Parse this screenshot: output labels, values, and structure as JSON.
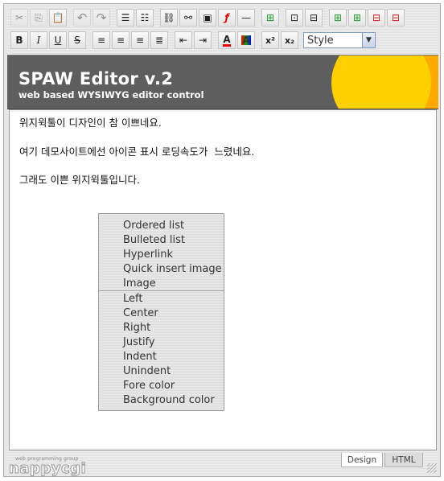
{
  "toolbar": {
    "row1": [
      {
        "icon": "cut-icon",
        "glyph": "✂",
        "dim": true
      },
      {
        "icon": "copy-icon",
        "glyph": "⎘",
        "dim": true
      },
      {
        "icon": "paste-icon",
        "glyph": "📋",
        "dim": false
      },
      {
        "sep": true
      },
      {
        "icon": "undo-icon",
        "glyph": "↶",
        "dim": true
      },
      {
        "icon": "redo-icon",
        "glyph": "↷",
        "dim": true
      },
      {
        "sep": true
      },
      {
        "icon": "ordered-list-icon",
        "glyph": "☰",
        "dim": false
      },
      {
        "icon": "bulleted-list-icon",
        "glyph": "☷",
        "dim": false
      },
      {
        "sep": true
      },
      {
        "icon": "hyperlink-icon",
        "glyph": "⛓",
        "dim": false
      },
      {
        "icon": "unlink-icon",
        "glyph": "⚯",
        "dim": false
      },
      {
        "icon": "image-icon",
        "glyph": "▣",
        "dim": false
      },
      {
        "icon": "flash-icon",
        "glyph": "ƒ",
        "dim": false
      },
      {
        "icon": "horizontal-rule-icon",
        "glyph": "—",
        "dim": false
      },
      {
        "sep": true
      },
      {
        "icon": "create-table-icon",
        "glyph": "⊞",
        "dim": false
      },
      {
        "sep": true
      },
      {
        "icon": "table-properties-icon",
        "glyph": "⊡",
        "dim": false
      },
      {
        "icon": "cell-properties-icon",
        "glyph": "⊟",
        "dim": false
      },
      {
        "sep": true
      },
      {
        "icon": "insert-row-icon",
        "glyph": "⊞",
        "dim": false
      },
      {
        "icon": "insert-column-icon",
        "glyph": "⊞",
        "dim": false
      },
      {
        "icon": "delete-row-icon",
        "glyph": "⊟",
        "dim": false
      },
      {
        "icon": "delete-column-icon",
        "glyph": "⊟",
        "dim": false
      }
    ],
    "row2": [
      {
        "icon": "bold-icon",
        "glyph": "B",
        "style": "bold"
      },
      {
        "icon": "italic-icon",
        "glyph": "I",
        "style": "italic"
      },
      {
        "icon": "underline-icon",
        "glyph": "U",
        "style": "underline"
      },
      {
        "icon": "strikethrough-icon",
        "glyph": "S",
        "style": "strike"
      },
      {
        "sep": true
      },
      {
        "icon": "align-left-icon",
        "glyph": "≡"
      },
      {
        "icon": "align-center-icon",
        "glyph": "≡"
      },
      {
        "icon": "align-right-icon",
        "glyph": "≡"
      },
      {
        "icon": "justify-icon",
        "glyph": "≣"
      },
      {
        "sep": true
      },
      {
        "icon": "outdent-icon",
        "glyph": "⇤"
      },
      {
        "icon": "indent-icon",
        "glyph": "⇥"
      },
      {
        "sep": true
      },
      {
        "icon": "fore-color-icon",
        "glyph": "A"
      },
      {
        "icon": "background-color-icon",
        "glyph": "A"
      },
      {
        "sep": true
      },
      {
        "icon": "superscript-icon",
        "glyph": "x²"
      },
      {
        "icon": "subscript-icon",
        "glyph": "x₂"
      }
    ],
    "style_select": {
      "value": "Style"
    }
  },
  "banner": {
    "title": "SPAW Editor v.2",
    "subtitle": "web based WYSIWYG editor control"
  },
  "content": {
    "paragraphs": [
      "위지윅툴이 디자인이 참 이쁘네요.",
      "여기 데모사이트에선 아이콘 표시 로딩속도가  느렸네요.",
      "그래도 이쁜 위지윅툴입니다."
    ]
  },
  "context_menu": {
    "group1": [
      "Ordered list",
      "Bulleted list",
      "Hyperlink",
      "Quick insert image",
      "Image"
    ],
    "group2": [
      "Left",
      "Center",
      "Right",
      "Justify",
      "Indent",
      "Unindent",
      "Fore color",
      "Background color"
    ]
  },
  "footer": {
    "brand_tagline": "web programming group",
    "brand_name": "nappycgi",
    "tabs": [
      "Design",
      "HTML"
    ]
  },
  "colors": {
    "banner_bg": "#5e5e5e",
    "arc_yellow": "#ffd000",
    "arc_orange_light": "#ffa800",
    "arc_orange": "#ff7f00",
    "arc_red_orange": "#ff5a00"
  }
}
